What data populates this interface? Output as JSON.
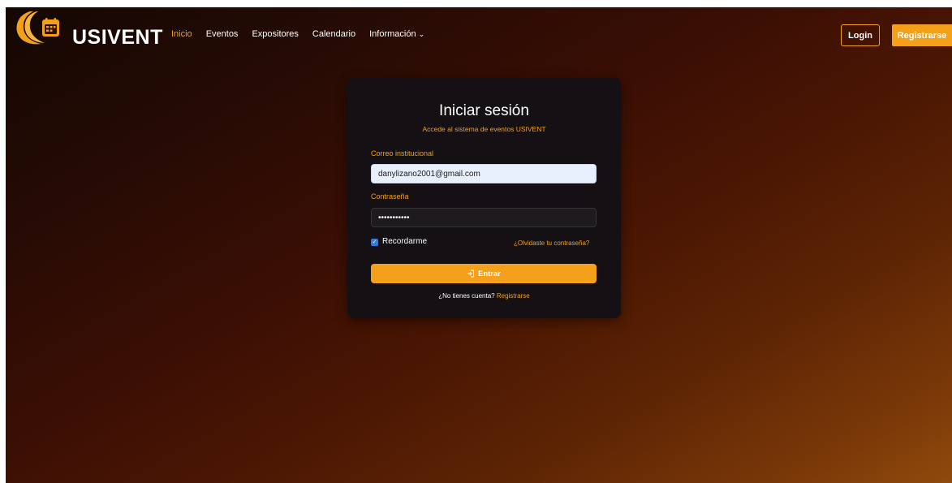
{
  "brand": {
    "name": "USIVENT"
  },
  "nav": {
    "items": [
      {
        "label": "Inicio"
      },
      {
        "label": "Eventos"
      },
      {
        "label": "Expositores"
      },
      {
        "label": "Calendario"
      },
      {
        "label": "Información"
      }
    ],
    "login_label": "Login",
    "register_label": "Registrarse"
  },
  "login": {
    "title": "Iniciar sesión",
    "subtitle": "Accede al sistema de eventos USIVENT",
    "email_label": "Correo institucional",
    "email_value": "danylizano2001@gmail.com",
    "password_label": "Contraseña",
    "password_value": "•••••••••••",
    "remember_label": "Recordarme",
    "remember_checked": true,
    "forgot_label": "¿Olvidaste tu contraseña?",
    "submit_label": "Entrar",
    "no_account_label": "¿No tienes cuenta?",
    "signup_link": "Registrarse"
  },
  "colors": {
    "accent": "#f5a01a",
    "card_bg": "#141013",
    "checkbox": "#2d7ae8"
  },
  "icons": {
    "logo": "calendar-icon",
    "dropdown": "chevron-down-icon",
    "submit": "login-icon",
    "checkbox": "check-icon"
  }
}
